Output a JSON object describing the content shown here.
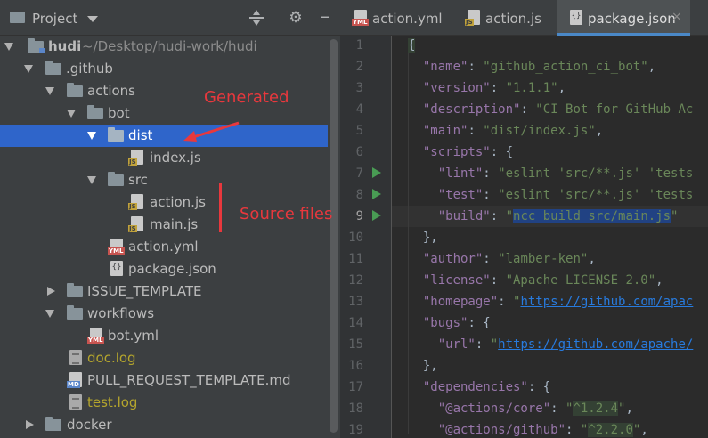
{
  "colors": {
    "accent": "#2f65ca",
    "annotation": "#e8383d",
    "run": "#499c54",
    "key": "#9876aa",
    "string": "#6a8759",
    "url": "#287bde"
  },
  "project_pane": {
    "title": "Project",
    "icons": [
      "collapse-all-icon",
      "gear-icon",
      "hide-icon"
    ]
  },
  "tree": [
    {
      "label": "hudi",
      "path": "~/Desktop/hudi-work/hudi",
      "type": "module-folder",
      "expanded": true
    },
    {
      "label": ".github",
      "type": "folder",
      "expanded": true
    },
    {
      "label": "actions",
      "type": "folder",
      "expanded": true
    },
    {
      "label": "bot",
      "type": "folder",
      "expanded": true
    },
    {
      "label": "dist",
      "type": "folder",
      "expanded": true,
      "selected": true
    },
    {
      "label": "index.js",
      "type": "js"
    },
    {
      "label": "src",
      "type": "folder",
      "expanded": true
    },
    {
      "label": "action.js",
      "type": "js"
    },
    {
      "label": "main.js",
      "type": "js"
    },
    {
      "label": "action.yml",
      "type": "yml"
    },
    {
      "label": "package.json",
      "type": "json"
    },
    {
      "label": "ISSUE_TEMPLATE",
      "type": "folder",
      "expanded": false
    },
    {
      "label": "workflows",
      "type": "folder",
      "expanded": true
    },
    {
      "label": "bot.yml",
      "type": "yml"
    },
    {
      "label": "doc.log",
      "type": "log"
    },
    {
      "label": "PULL_REQUEST_TEMPLATE.md",
      "type": "md"
    },
    {
      "label": "test.log",
      "type": "log"
    },
    {
      "label": "docker",
      "type": "folder",
      "expanded": false
    }
  ],
  "annotations": {
    "generated": "Generated",
    "source_files": "Source files"
  },
  "tabs": [
    {
      "label": "action.yml",
      "icon": "yml"
    },
    {
      "label": "action.js",
      "icon": "js"
    },
    {
      "label": "package.json",
      "icon": "json",
      "active": true
    }
  ],
  "tab_close_glyph": "×",
  "editor": {
    "current_line": 9,
    "run_lines": [
      7,
      8,
      9
    ],
    "line_numbers": [
      "1",
      "2",
      "3",
      "4",
      "5",
      "6",
      "7",
      "8",
      "9",
      "10",
      "11",
      "12",
      "13",
      "14",
      "15",
      "16",
      "17",
      "18",
      "19"
    ],
    "lines": [
      "{",
      "  \"name\": \"github_action_ci_bot\",",
      "  \"version\": \"1.1.1\",",
      "  \"description\": \"CI Bot for GitHub Ac",
      "  \"main\": \"dist/index.js\",",
      "  \"scripts\": {",
      "    \"lint\": \"eslint 'src/**.js' 'tests",
      "    \"test\": \"eslint 'src/**.js' 'tests",
      "    \"build\": \"ncc build src/main.js\"",
      "  },",
      "  \"author\": \"lamber-ken\",",
      "  \"license\": \"Apache LICENSE 2.0\",",
      "  \"homepage\": \"https://github.com/apac",
      "  \"bugs\": {",
      "    \"url\": \"https://github.com/apache/",
      "  },",
      "  \"dependencies\": {",
      "    \"@actions/core\": \"^1.2.4\",",
      "    \"@actions/github\": \"^2.2.0\","
    ]
  }
}
